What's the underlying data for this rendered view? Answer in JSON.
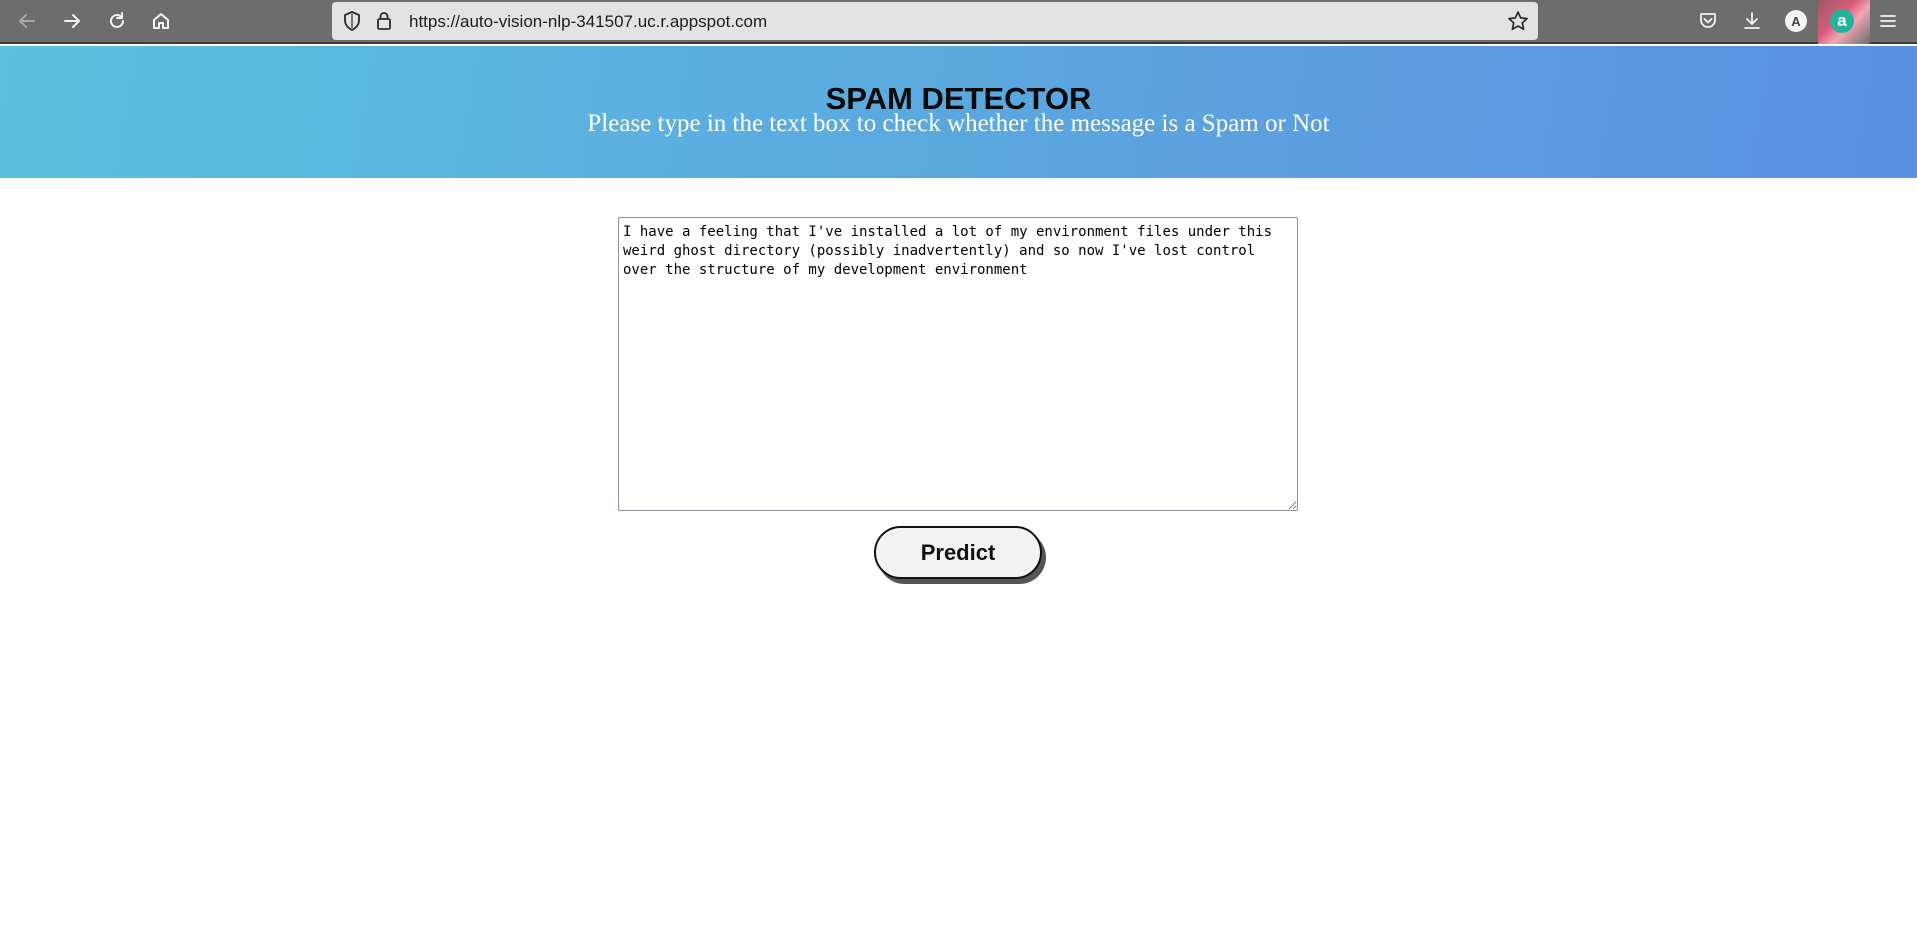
{
  "browser": {
    "url": "https://auto-vision-nlp-341507.uc.r.appspot.com",
    "avatar_letter": "A",
    "extension_letter": "a",
    "icons": {
      "back": "back-arrow-icon",
      "forward": "forward-arrow-icon",
      "reload": "reload-icon",
      "home": "home-icon",
      "shield": "tracking-protection-shield-icon",
      "lock": "lock-icon",
      "bookmark": "bookmark-star-icon",
      "pocket": "pocket-icon",
      "downloads": "downloads-icon",
      "menu": "hamburger-menu-icon"
    }
  },
  "header": {
    "title": "SPAM DETECTOR",
    "subtitle": "Please type in the text box to check whether the message is a Spam or Not",
    "gradient_start": "#5bc1de",
    "gradient_end": "#5b8fe0"
  },
  "form": {
    "message_value": "I have a feeling that I've installed a lot of my environment files under this weird ghost directory (possibly inadvertently) and so now I've lost control over the structure of my development environment",
    "predict_label": "Predict"
  }
}
